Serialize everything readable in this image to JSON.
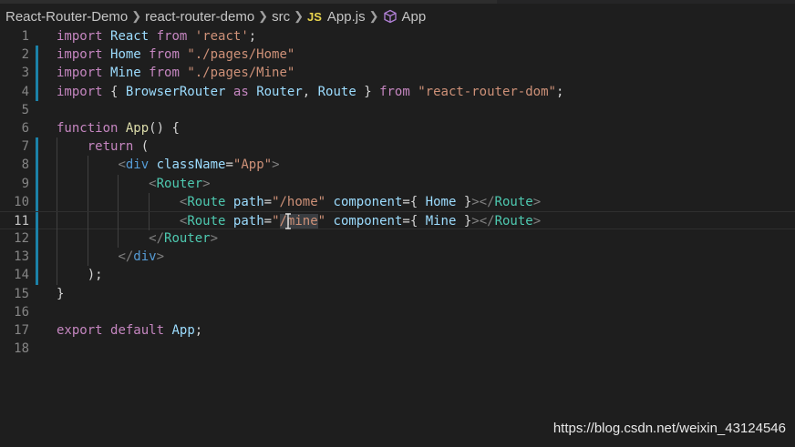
{
  "breadcrumb": {
    "items": [
      "React-Router-Demo",
      "react-router-demo",
      "src",
      "App.js",
      "App"
    ],
    "file_badge": "JS"
  },
  "editor": {
    "active_line": 11,
    "lines": [
      {
        "n": "1",
        "t": "import React from 'react';"
      },
      {
        "n": "2",
        "t": "import Home from \"./pages/Home\""
      },
      {
        "n": "3",
        "t": "import Mine from \"./pages/Mine\""
      },
      {
        "n": "4",
        "t": "import { BrowserRouter as Router, Route } from \"react-router-dom\";"
      },
      {
        "n": "5",
        "t": ""
      },
      {
        "n": "6",
        "t": "function App() {"
      },
      {
        "n": "7",
        "t": "return ("
      },
      {
        "n": "8",
        "t": "<div className=\"App\">"
      },
      {
        "n": "9",
        "t": "<Router>"
      },
      {
        "n": "10",
        "t": "<Route path=\"/home\" component={ Home }></Route>"
      },
      {
        "n": "11",
        "t": "<Route path=\"/mine\" component={ Mine }></Route>"
      },
      {
        "n": "12",
        "t": "</Router>"
      },
      {
        "n": "13",
        "t": "</div>"
      },
      {
        "n": "14",
        "t": ");"
      },
      {
        "n": "15",
        "t": "}"
      },
      {
        "n": "16",
        "t": ""
      },
      {
        "n": "17",
        "t": "export default App;"
      },
      {
        "n": "18",
        "t": ""
      }
    ]
  },
  "watermark": "https://blog.csdn.net/weixin_43124546",
  "colors": {
    "background": "#1e1e1e",
    "keyword": "#c586c0",
    "function": "#dcdcaa",
    "string": "#ce9178",
    "variable": "#9cdcfe",
    "component": "#4ec9b0",
    "tag": "#569cd6"
  },
  "icons": [
    "js-file-icon",
    "cube-symbol-icon",
    "chevron-right-icon",
    "text-cursor-icon"
  ]
}
